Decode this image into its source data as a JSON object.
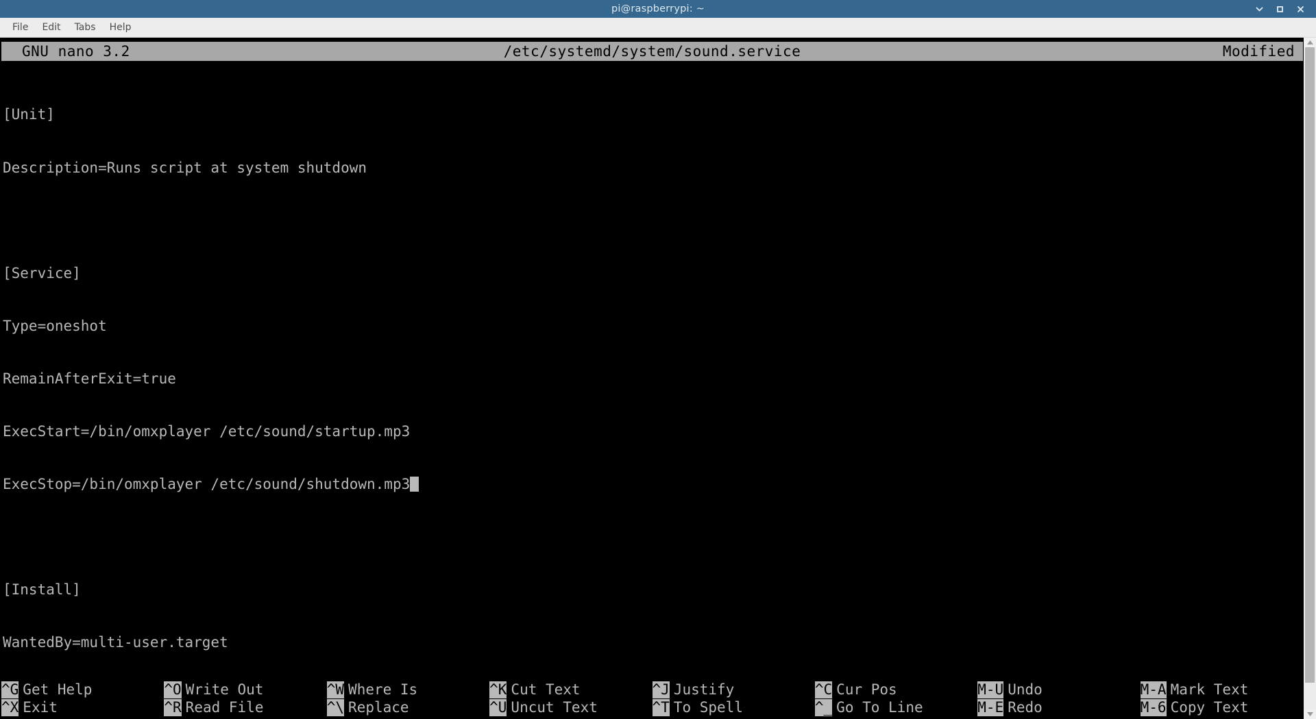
{
  "window": {
    "title": "pi@raspberrypi: ~",
    "controls": [
      {
        "name": "minimize-button",
        "glyph": "chevron-down-icon"
      },
      {
        "name": "maximize-button",
        "glyph": "square-icon"
      },
      {
        "name": "close-button",
        "glyph": "close-icon"
      }
    ],
    "accent_color": "#36688f"
  },
  "menubar": {
    "items": [
      {
        "label": "File"
      },
      {
        "label": "Edit"
      },
      {
        "label": "Tabs"
      },
      {
        "label": "Help"
      }
    ]
  },
  "nano": {
    "version_label": "GNU nano 3.2",
    "filename": "/etc/systemd/system/sound.service",
    "status": "Modified",
    "titlebar_bg": "#a8a8a8",
    "text_color": "#b9b9b9",
    "background_color": "#000000"
  },
  "editor": {
    "lines": [
      "[Unit]",
      "Description=Runs script at system shutdown",
      "",
      "[Service]",
      "Type=oneshot",
      "RemainAfterExit=true",
      "ExecStart=/bin/omxplayer /etc/sound/startup.mp3",
      "ExecStop=/bin/omxplayer /etc/sound/shutdown.mp3",
      "",
      "[Install]",
      "WantedBy=multi-user.target"
    ],
    "cursor_line_index": 7,
    "cursor_column": 48
  },
  "shortcuts": {
    "columns": [
      [
        {
          "key": "^G",
          "label": "Get Help"
        },
        {
          "key": "^X",
          "label": "Exit"
        }
      ],
      [
        {
          "key": "^O",
          "label": "Write Out"
        },
        {
          "key": "^R",
          "label": "Read File"
        }
      ],
      [
        {
          "key": "^W",
          "label": "Where Is"
        },
        {
          "key": "^\\",
          "label": "Replace"
        }
      ],
      [
        {
          "key": "^K",
          "label": "Cut Text"
        },
        {
          "key": "^U",
          "label": "Uncut Text"
        }
      ],
      [
        {
          "key": "^J",
          "label": "Justify"
        },
        {
          "key": "^T",
          "label": "To Spell"
        }
      ],
      [
        {
          "key": "^C",
          "label": "Cur Pos"
        },
        {
          "key": "^_",
          "label": "Go To Line"
        }
      ],
      [
        {
          "key": "M-U",
          "label": "Undo"
        },
        {
          "key": "M-E",
          "label": "Redo"
        }
      ],
      [
        {
          "key": "M-A",
          "label": "Mark Text"
        },
        {
          "key": "M-6",
          "label": "Copy Text"
        }
      ]
    ]
  },
  "scrollbar": {
    "up_arrow": "scroll-up-arrow-icon",
    "down_arrow": "scroll-down-arrow-icon",
    "thumb_position_percent": 0
  }
}
